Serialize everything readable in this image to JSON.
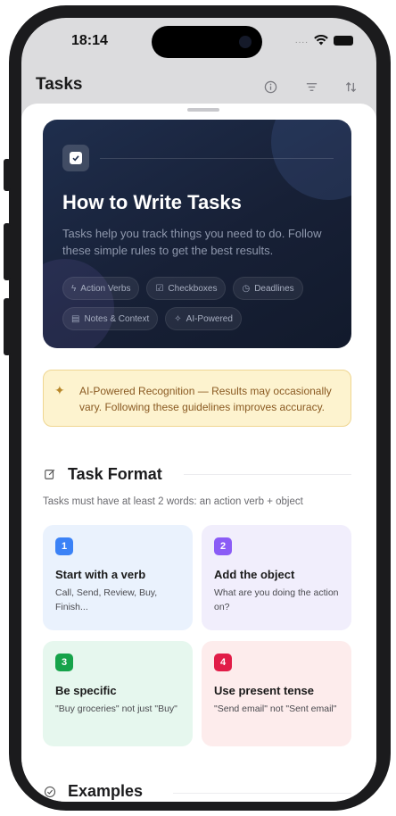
{
  "status_bar": {
    "time": "18:14",
    "signal_dots": "...."
  },
  "nav": {
    "title": "Tasks"
  },
  "hero": {
    "title": "How to Write Tasks",
    "description": "Tasks help you track things you need to do. Follow these simple rules to get the best results.",
    "pills": [
      {
        "icon": "lightning-icon",
        "label": "Action Verbs"
      },
      {
        "icon": "checkbox-icon",
        "label": "Checkboxes"
      },
      {
        "icon": "clock-icon",
        "label": "Deadlines"
      },
      {
        "icon": "note-icon",
        "label": "Notes & Context"
      },
      {
        "icon": "sparkles-icon",
        "label": "AI-Powered"
      }
    ]
  },
  "alert": {
    "text": "AI-Powered Recognition — Results may occasionally vary. Following these guidelines improves accuracy.",
    "color": "#fdf3cf"
  },
  "task_format": {
    "title": "Task Format",
    "subtitle": "Tasks must have at least 2 words: an action verb + object",
    "cards": [
      {
        "num": "1",
        "title": "Start with a verb",
        "desc": "Call, Send, Review, Buy, Finish...",
        "badge_color": "#3b82f6",
        "bg_color": "#eaf2fd"
      },
      {
        "num": "2",
        "title": "Add the object",
        "desc": "What are you doing the action on?",
        "badge_color": "#8b5cf6",
        "bg_color": "#f1eefc"
      },
      {
        "num": "3",
        "title": "Be specific",
        "desc": "\"Buy groceries\" not just \"Buy\"",
        "badge_color": "#16a34a",
        "bg_color": "#e6f7ee"
      },
      {
        "num": "4",
        "title": "Use present tense",
        "desc": "\"Send email\" not \"Sent email\"",
        "badge_color": "#e11d48",
        "bg_color": "#fdecec"
      }
    ]
  },
  "examples": {
    "title": "Examples"
  }
}
